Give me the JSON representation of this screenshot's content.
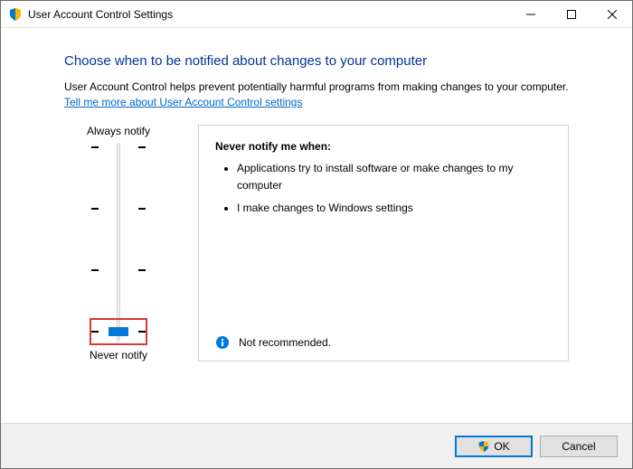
{
  "window": {
    "title": "User Account Control Settings"
  },
  "heading": "Choose when to be notified about changes to your computer",
  "description": "User Account Control helps prevent potentially harmful programs from making changes to your computer.",
  "link_text": "Tell me more about User Account Control settings",
  "slider": {
    "top_label": "Always notify",
    "bottom_label": "Never notify"
  },
  "info": {
    "title": "Never notify me when:",
    "bullets": [
      "Applications try to install software or make changes to my computer",
      "I make changes to Windows settings"
    ],
    "footer_text": "Not recommended."
  },
  "buttons": {
    "ok": "OK",
    "cancel": "Cancel"
  }
}
